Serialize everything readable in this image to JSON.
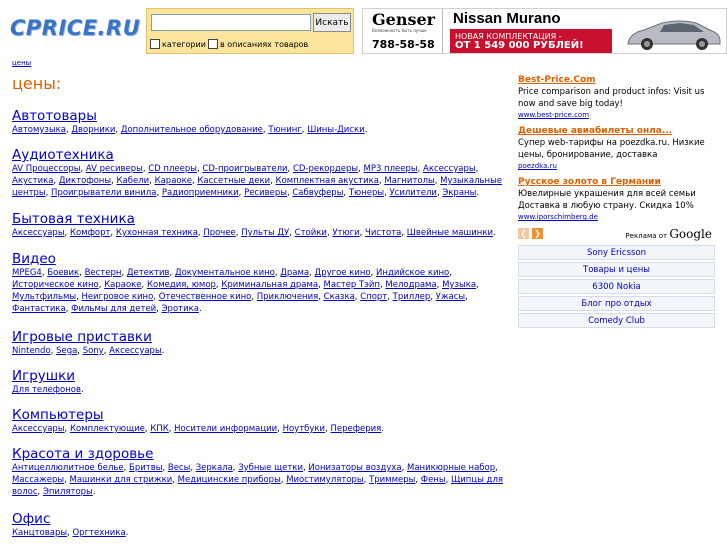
{
  "header": {
    "logo_text": "CPRICE.RU",
    "search": {
      "input_value": "",
      "button_label": "Искать",
      "checkbox_categories": "категории",
      "checkbox_descriptions": "в описаниях товаров"
    },
    "banner": {
      "genser_name": "Genser",
      "genser_slogan": "Возможность быть лучше",
      "genser_phone": "788-58-58",
      "nissan_title": "Nissan Murano",
      "nissan_line1": "НОВАЯ КОМПЛЕКТАЦИЯ -",
      "nissan_price": "ОТ 1 549 000 РУБЛЕЙ!"
    }
  },
  "breadcrumb": "цены",
  "page_title": "цены:",
  "categories": [
    {
      "title": "Автотовары",
      "links": [
        "Автомузыка",
        "Дворники",
        "Дополнительное оборудование",
        "Тюнинг",
        "Шины-Диски"
      ]
    },
    {
      "title": "Аудиотехника",
      "links": [
        "AV Процессоры",
        "AV ресиверы",
        "CD плееры",
        "CD-проигрыватели",
        "CD-рекордеры",
        "MP3 плееры",
        "Аксессуары",
        "Акустика",
        "Диктофоны",
        "Кабели",
        "Караоке",
        "Кассетные деки",
        "Комплектная акустика",
        "Магнитолы",
        "Музыкальные центры",
        "Проигрыватели винила",
        "Радиоприемники",
        "Ресиверы",
        "Сабвуферы",
        "Тюнеры",
        "Усилители",
        "Экраны"
      ]
    },
    {
      "title": "Бытовая техника",
      "links": [
        "Аксессуары",
        "Комфорт",
        "Кухонная техника",
        "Прочее",
        "Пульты ДУ",
        "Стойки",
        "Утюги",
        "Чистота",
        "Швейные машинки"
      ]
    },
    {
      "title": "Видео",
      "links": [
        "MPEG4",
        "Боевик",
        "Вестерн",
        "Детектив",
        "Документальное кино",
        "Драма",
        "Другое кино",
        "Индийское кино",
        "Историческое кино",
        "Караоке",
        "Комедия, юмор",
        "Криминальная драма",
        "Мастер Тэйп",
        "Мелодрама",
        "Музыка",
        "Мультфильмы",
        "Неигровое кино",
        "Отечественное кино",
        "Приключения",
        "Сказка",
        "Спорт",
        "Триллер",
        "Ужасы",
        "Фантастика",
        "Фильмы для детей",
        "Эротика"
      ]
    },
    {
      "title": "Игровые приставки",
      "links": [
        "Nintendo",
        "Sega",
        "Sony",
        "Аксессуары"
      ]
    },
    {
      "title": "Игрушки",
      "links": [
        "Для телефонов"
      ]
    },
    {
      "title": "Компьютеры",
      "links": [
        "Аксессуары",
        "Комплектующие",
        "КПК",
        "Носители информации",
        "Ноутбуки",
        "Переферия"
      ]
    },
    {
      "title": "Красота и здоровье",
      "links": [
        "Антицеллюлитное белье",
        "Бритвы",
        "Весы",
        "Зеркала",
        "Зубные щетки",
        "Ионизаторы воздуха",
        "Маникюрные набор",
        "Массажеры",
        "Машинки для стрижки",
        "Медицинские приборы",
        "Миостимуляторы",
        "Триммеры",
        "Фены",
        "Щипцы для волос",
        "Эпиляторы"
      ]
    },
    {
      "title": "Офис",
      "links": [
        "Канцтовары",
        "Оргтехника"
      ]
    }
  ],
  "ads": [
    {
      "title": "Best-Price.Com",
      "text": "Price comparison and product infos: Visit us now and save big today!",
      "url": "www.best-price.com"
    },
    {
      "title": "Дешевые авиабилеты онла...",
      "text": "Супер web-тарифы на poezdka.ru. Низкие цены, бронирование, доставка",
      "url": "poezdka.ru"
    },
    {
      "title": "Русское золото в Германии",
      "text": "Ювелирные украшения для всей семьи Доставка в любую страну. Скидка 10%",
      "url": "www.iporschimberg.de"
    }
  ],
  "ads_by": "Реклама от",
  "ads_by_brand": "Google",
  "tags": [
    "Sony Ericsson",
    "Товары и цены",
    "6300 Nokia",
    "Блог про отдых",
    "Comedy Club"
  ],
  "colors": {
    "link": "#0000cc",
    "accent": "#e06000",
    "search_bg": "#fbe49c",
    "nissan_red": "#c8102e"
  }
}
